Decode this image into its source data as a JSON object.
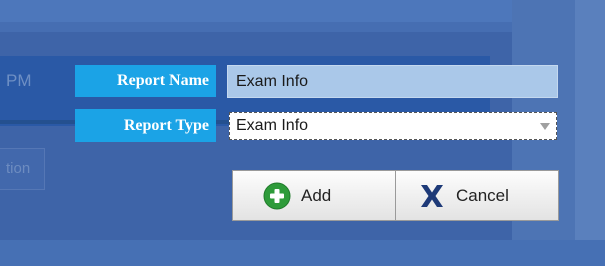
{
  "background": {
    "time_fragment": "PM",
    "ghost_button_text": "tion"
  },
  "form": {
    "report_name": {
      "label": "Report Name",
      "value": "Exam Info"
    },
    "report_type": {
      "label": "Report Type",
      "selected": "Exam Info"
    }
  },
  "actions": {
    "add_label": "Add",
    "cancel_label": "Cancel"
  },
  "colors": {
    "label_bg": "#1ba3e6",
    "add_icon": "#2e9b3a",
    "cancel_icon": "#1e3a78"
  },
  "icons": {
    "add": "plus-circle-icon",
    "cancel": "x-icon"
  }
}
